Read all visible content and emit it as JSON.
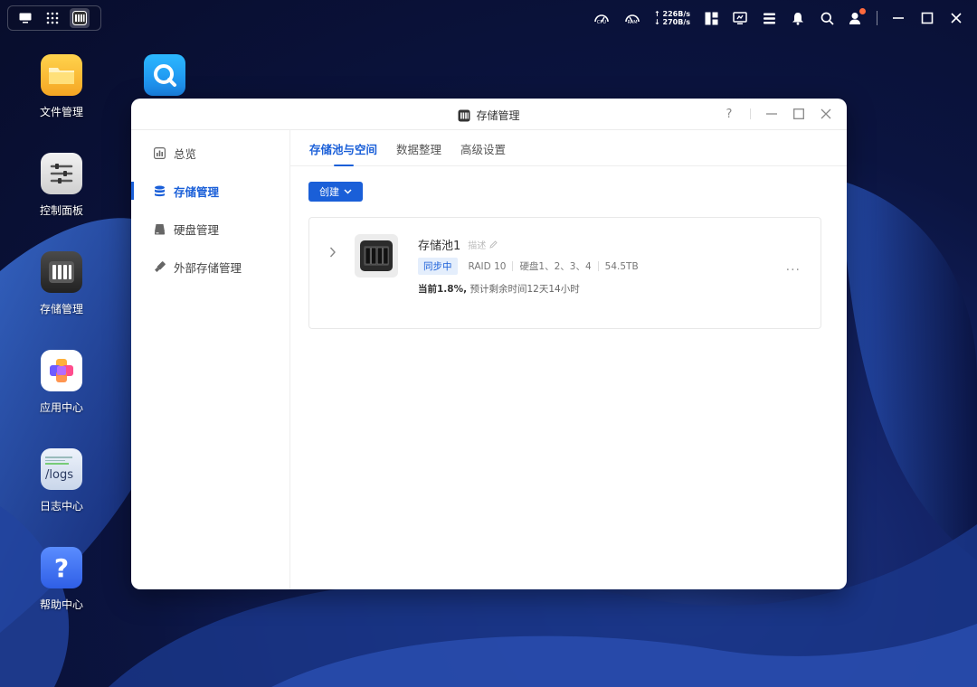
{
  "desktop": {
    "icons": [
      {
        "label": "文件管理",
        "icon": "folder-icon"
      },
      {
        "label": "控制面板",
        "icon": "sliders-icon"
      },
      {
        "label": "存储管理",
        "icon": "storage-icon"
      },
      {
        "label": "应用中心",
        "icon": "app-center-icon"
      },
      {
        "label": "日志中心",
        "icon": "logs-icon",
        "tile_text": "/logs"
      },
      {
        "label": "帮助中心",
        "icon": "help-icon",
        "tile_text": "?"
      }
    ],
    "floating_icon": "search-app-icon"
  },
  "topbar": {
    "cpu_label": "CPU",
    "ram_label": "RAM",
    "upload": "226B/s",
    "download": "270B/s"
  },
  "window": {
    "title": "存储管理",
    "help": "?",
    "sidebar": [
      {
        "label": "总览",
        "icon": "overview-icon"
      },
      {
        "label": "存储管理",
        "icon": "database-icon",
        "active": true
      },
      {
        "label": "硬盘管理",
        "icon": "disk-icon"
      },
      {
        "label": "外部存储管理",
        "icon": "usb-drive-icon"
      }
    ],
    "tabs": [
      {
        "label": "存储池与空间",
        "active": true
      },
      {
        "label": "数据整理"
      },
      {
        "label": "高级设置"
      }
    ],
    "create_button": "创建",
    "pool": {
      "name": "存储池1",
      "desc_label": "描述",
      "status": "同步中",
      "raid": "RAID 10",
      "disks": "硬盘1、2、3、4",
      "capacity": "54.5TB",
      "progress_bold": "当前1.8%,",
      "progress_rest": "预计剩余时间12天14小时"
    }
  },
  "colors": {
    "accent": "#1a5fd8",
    "badge_bg": "#e4eefc",
    "notification": "#ff6a3d"
  }
}
